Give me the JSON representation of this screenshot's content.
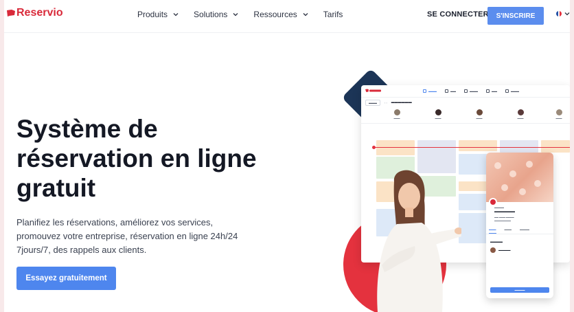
{
  "brand": {
    "name": "Reservio",
    "color": "#d92a3a"
  },
  "nav": {
    "items": [
      {
        "label": "Produits",
        "dropdown": true
      },
      {
        "label": "Solutions",
        "dropdown": true
      },
      {
        "label": "Ressources",
        "dropdown": true
      },
      {
        "label": "Tarifs",
        "dropdown": false
      }
    ],
    "signin_label": "SE CONNECTER",
    "signup_label": "S'INSCRIRE",
    "language_icon": "french-flag-icon"
  },
  "hero": {
    "title_lines": [
      "Système de",
      "réservation en ligne",
      "gratuit"
    ],
    "description_lines": [
      "Planifiez les réservations, améliorez vos services,",
      "promouvez votre entreprise, réservation en ligne 24h/24",
      "7jours/7, des rappels aux clients."
    ],
    "cta_label": "Essayez gratuitement"
  },
  "colors": {
    "accent": "#4e86ee",
    "red": "#e4323e",
    "navy": "#1c3557"
  }
}
